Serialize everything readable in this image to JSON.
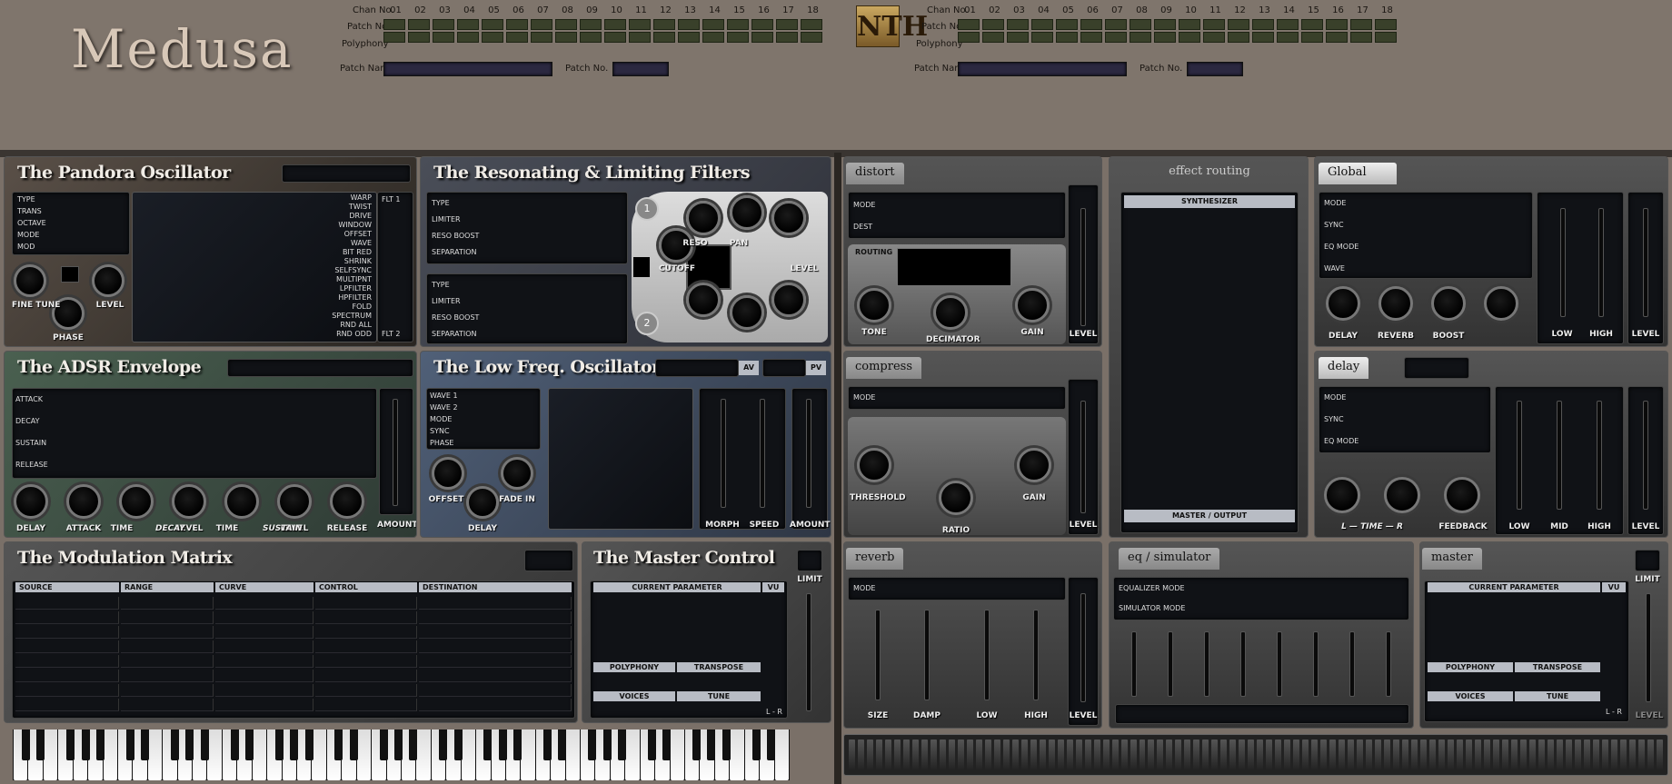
{
  "header": {
    "chan_label": "Chan No.",
    "patch_label": "Patch No.",
    "poly_label": "Polyphony",
    "patch_name_label": "Patch Name",
    "patch_no_label": "Patch No.",
    "channels": [
      "01",
      "02",
      "03",
      "04",
      "05",
      "06",
      "07",
      "08",
      "09",
      "10",
      "11",
      "12",
      "13",
      "14",
      "15",
      "16",
      "17",
      "18"
    ],
    "logo": "Medusa",
    "logo2": "NTH"
  },
  "osc": {
    "title": "The Pandora Oscillator",
    "rows": [
      "TYPE",
      "TRANS",
      "OCTAVE",
      "MODE",
      "MOD"
    ],
    "effects": [
      "WARP",
      "TWIST",
      "DRIVE",
      "WINDOW",
      "OFFSET",
      "WAVE",
      "BIT RED",
      "SHRINK",
      "SELFSYNC",
      "MULTIPNT",
      "LPFILTER",
      "HPFILTER",
      "FOLD",
      "SPECTRUM",
      "RND ALL",
      "RND ODD"
    ],
    "flt1": "FLT 1",
    "flt2": "FLT 2",
    "knobs": {
      "fine_tune": "FINE TUNE",
      "level": "LEVEL",
      "phase": "PHASE"
    }
  },
  "filters": {
    "title": "The Resonating & Limiting Filters",
    "rows": [
      "TYPE",
      "LIMITER",
      "RESO BOOST",
      "SEPARATION"
    ],
    "knobs": {
      "reso": "RESO",
      "pan": "PAN",
      "cutoff": "CUTOFF",
      "level": "LEVEL"
    },
    "n1": "1",
    "n2": "2"
  },
  "adsr": {
    "title": "The ADSR Envelope",
    "rows": [
      "ATTACK",
      "DECAY",
      "SUSTAIN",
      "RELEASE"
    ],
    "knobs": [
      "DELAY",
      "ATTACK",
      "TIME",
      "LEVEL",
      "TIME",
      "LEVEL",
      "RELEASE"
    ],
    "decay": "DECAY",
    "sustain": "SUSTAIN",
    "amount": "AMOUNT"
  },
  "lfo": {
    "title": "The Low Freq. Oscillator",
    "av": "AV",
    "pv": "PV",
    "rows": [
      "WAVE 1",
      "WAVE 2",
      "MODE",
      "SYNC",
      "PHASE"
    ],
    "knobs": {
      "offset": "OFFSET",
      "fade_in": "FADE IN",
      "delay": "DELAY"
    },
    "morph": "MORPH",
    "speed": "SPEED",
    "amount": "AMOUNT"
  },
  "matrix": {
    "title": "The Modulation Matrix",
    "cols": [
      "SOURCE",
      "RANGE",
      "CURVE",
      "CONTROL",
      "DESTINATION"
    ]
  },
  "master_ctrl": {
    "title": "The Master Control",
    "current": "CURRENT PARAMETER",
    "vu": "VU",
    "polyphony": "POLYPHONY",
    "transpose": "TRANSPOSE",
    "voices": "VOICES",
    "tune": "TUNE",
    "limit": "LIMIT",
    "lr": "L - R"
  },
  "distort": {
    "tab": "distort",
    "rows": [
      "MODE",
      "DEST"
    ],
    "routing": "ROUTING",
    "knobs": [
      "TONE",
      "DECIMATOR",
      "GAIN"
    ],
    "level": "LEVEL"
  },
  "compress": {
    "tab": "compress",
    "row": "MODE",
    "knobs": [
      "THRESHOLD",
      "RATIO",
      "GAIN"
    ],
    "level": "LEVEL"
  },
  "routing": {
    "title": "effect routing",
    "top": "SYNTHESIZER",
    "bottom": "MASTER / OUTPUT"
  },
  "global": {
    "tab": "Global",
    "rows": [
      "MODE",
      "SYNC",
      "EQ MODE",
      "WAVE"
    ],
    "knobs": [
      "DELAY",
      "REVERB",
      "BOOST"
    ],
    "low": "LOW",
    "high": "HIGH",
    "level": "LEVEL"
  },
  "delay": {
    "tab": "delay",
    "rows": [
      "MODE",
      "SYNC",
      "EQ MODE"
    ],
    "time": "L — TIME — R",
    "feedback": "FEEDBACK",
    "low": "LOW",
    "mid": "MID",
    "high": "HIGH",
    "level": "LEVEL"
  },
  "reverb": {
    "tab": "reverb",
    "row": "MODE",
    "sliders": [
      "SIZE",
      "DAMP",
      "LOW",
      "HIGH"
    ],
    "level": "LEVEL"
  },
  "eq": {
    "tab": "eq / simulator",
    "rows": [
      "EQUALIZER MODE",
      "SIMULATOR MODE"
    ]
  },
  "master": {
    "tab": "master",
    "current": "CURRENT PARAMETER",
    "vu": "VU",
    "polyphony": "POLYPHONY",
    "transpose": "TRANSPOSE",
    "voices": "VOICES",
    "tune": "TUNE",
    "limit": "LIMIT",
    "level": "LEVEL",
    "lr": "L - R"
  }
}
